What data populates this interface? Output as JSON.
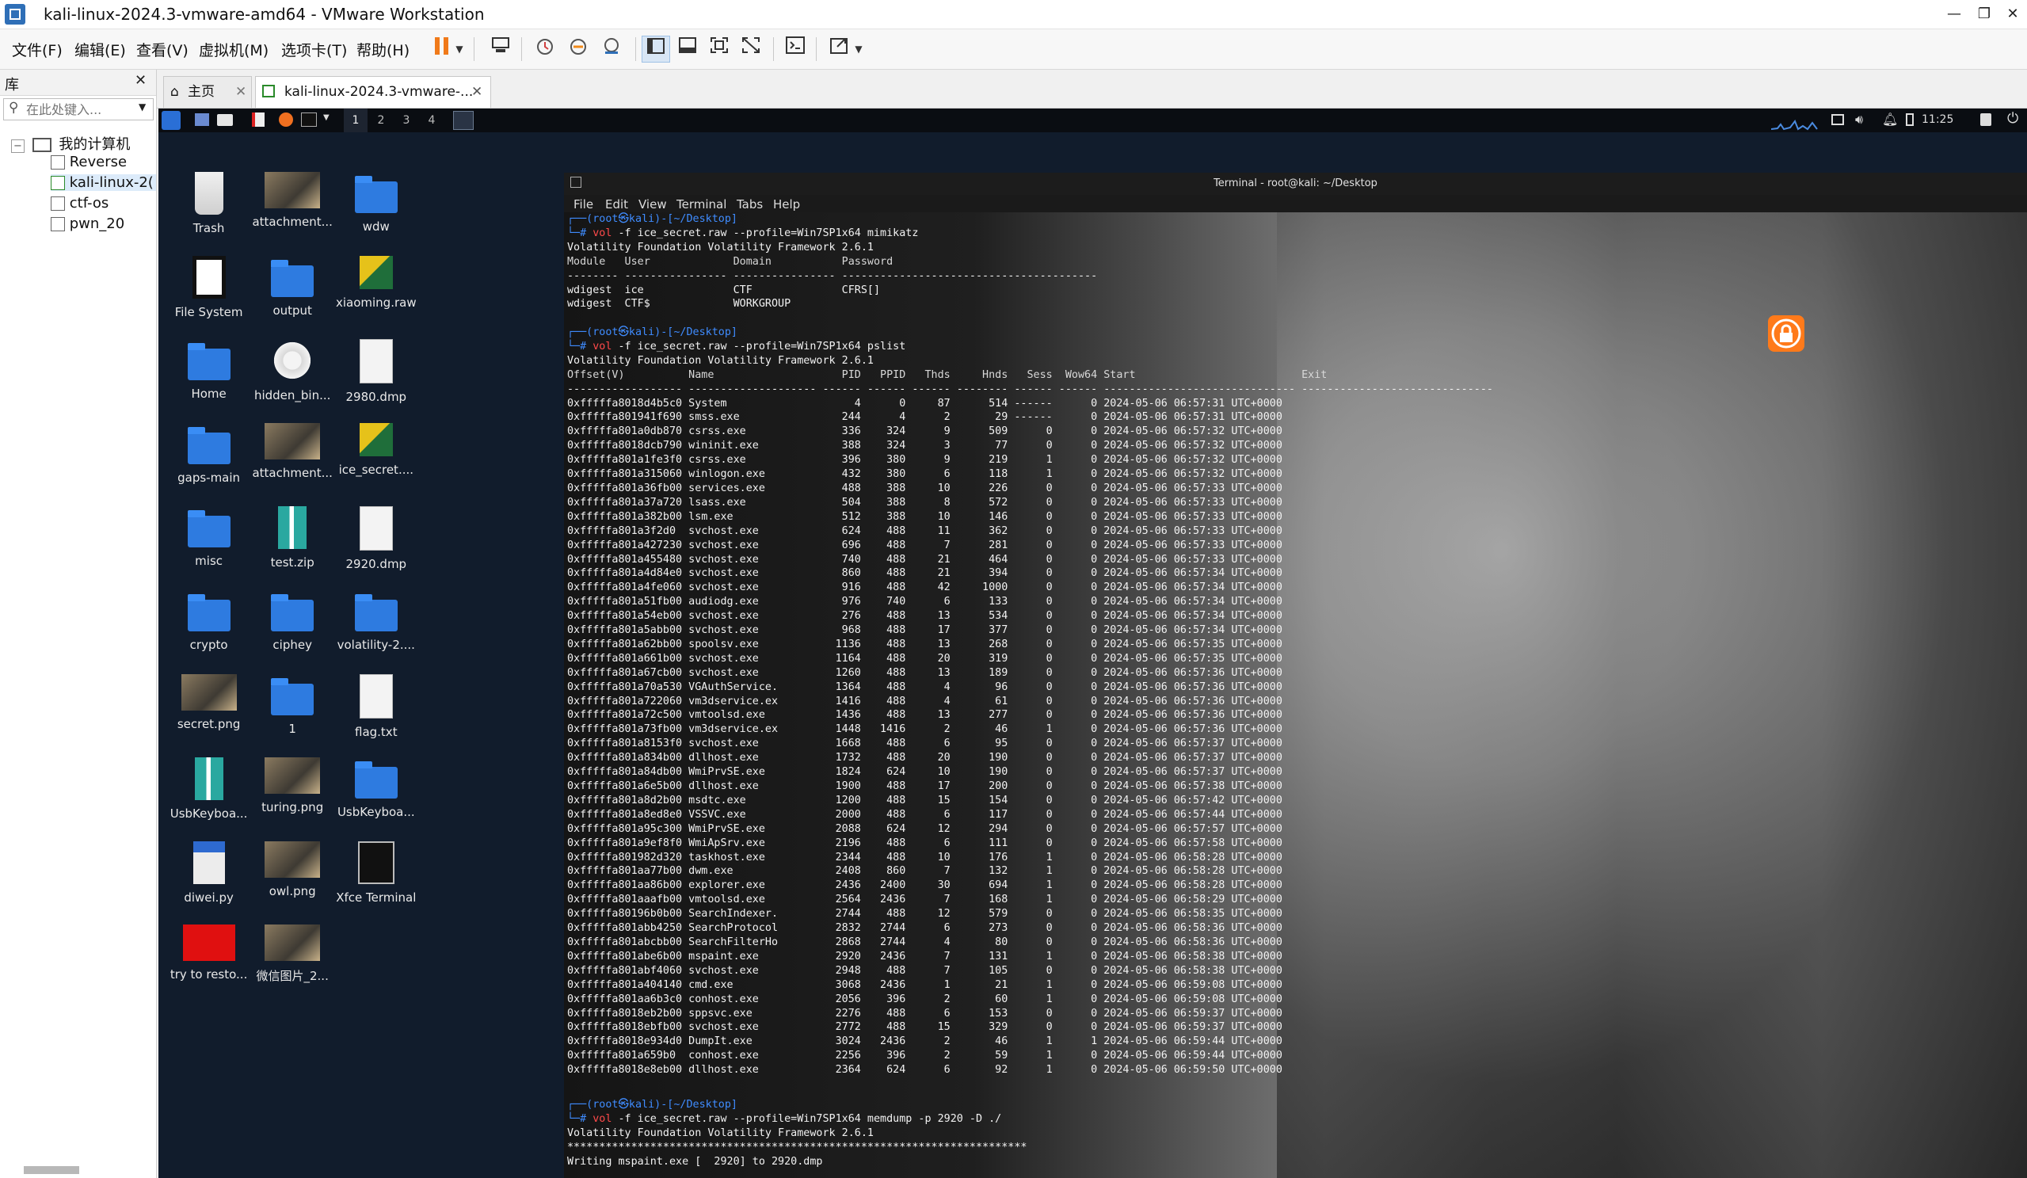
{
  "window": {
    "title": "kali-linux-2024.3-vmware-amd64 - VMware Workstation",
    "controls": [
      "—",
      "❐",
      "✕"
    ]
  },
  "menu": [
    "文件(F)",
    "编辑(E)",
    "查看(V)",
    "虚拟机(M)",
    "选项卡(T)",
    "帮助(H)"
  ],
  "library": {
    "title": "库",
    "search_placeholder": "在此处键入...",
    "root": "我的计算机",
    "vms": [
      "Reverse",
      "kali-linux-2(",
      "ctf-os",
      "pwn_20"
    ]
  },
  "tabs": [
    {
      "label": "主页"
    },
    {
      "label": "kali-linux-2024.3-vmware-..."
    }
  ],
  "panel": {
    "workspaces": [
      "1",
      "2",
      "3",
      "4"
    ],
    "time": "11:25"
  },
  "desktop_icons": [
    {
      "label": "Trash",
      "kind": "trash"
    },
    {
      "label": "attachment...",
      "kind": "image"
    },
    {
      "label": "wdw",
      "kind": "folder"
    },
    {
      "label": "File System",
      "kind": "drive"
    },
    {
      "label": "output",
      "kind": "folder"
    },
    {
      "label": "xiaoming.raw",
      "kind": "raw"
    },
    {
      "label": "Home",
      "kind": "folder"
    },
    {
      "label": "hidden_bin...",
      "kind": "gear"
    },
    {
      "label": "2980.dmp",
      "kind": "doc"
    },
    {
      "label": "gaps-main",
      "kind": "folder"
    },
    {
      "label": "attachment...",
      "kind": "image"
    },
    {
      "label": "ice_secret....",
      "kind": "raw"
    },
    {
      "label": "misc",
      "kind": "folder"
    },
    {
      "label": "test.zip",
      "kind": "zip"
    },
    {
      "label": "2920.dmp",
      "kind": "doc"
    },
    {
      "label": "crypto",
      "kind": "folder"
    },
    {
      "label": "ciphey",
      "kind": "folder"
    },
    {
      "label": "volatility-2....",
      "kind": "folder"
    },
    {
      "label": "secret.png",
      "kind": "image"
    },
    {
      "label": "1",
      "kind": "folder"
    },
    {
      "label": "flag.txt",
      "kind": "doc"
    },
    {
      "label": "UsbKeyboa...",
      "kind": "zip"
    },
    {
      "label": "turing.png",
      "kind": "image"
    },
    {
      "label": "UsbKeyboa...",
      "kind": "folder"
    },
    {
      "label": "diwei.py",
      "kind": "py"
    },
    {
      "label": "owl.png",
      "kind": "image"
    },
    {
      "label": "Xfce Terminal",
      "kind": "terminal"
    },
    {
      "label": "try to resto...",
      "kind": "red"
    },
    {
      "label": "微信图片_2...",
      "kind": "image"
    }
  ],
  "terminal": {
    "title": "Terminal - root@kali: ~/Desktop",
    "menu": [
      "File",
      "Edit",
      "View",
      "Terminal",
      "Tabs",
      "Help"
    ],
    "prompt_top": "┌──(root㉿kali)-[~/Desktop]",
    "prompt_mark": "└─#",
    "cmd1": {
      "bin": "vol",
      "args": " -f ice_secret.raw --profile=Win7SP1x64 mimikatz"
    },
    "banner": "Volatility Foundation Volatility Framework 2.6.1",
    "mimikatz_header": "Module   User             Domain           Password",
    "mimikatz_sep": "-------- ---------------- ---------------- ----------------------------------------",
    "mimikatz_rows": [
      "wdigest  ice              CTF              CFRS[]",
      "wdigest  CTF$             WORKGROUP"
    ],
    "cmd2": {
      "bin": "vol",
      "args": " -f ice_secret.raw --profile=Win7SP1x64 pslist"
    },
    "pslist_header": "Offset(V)          Name                    PID   PPID   Thds     Hnds   Sess  Wow64 Start                          Exit",
    "pslist_sep": "------------------ -------------------- ------ ------ ------ -------- ------ ------ ------------------------------ ------------------------------",
    "pslist_rows": [
      "0xfffffa8018d4b5c0 System                    4      0     87      514 ------      0 2024-05-06 06:57:31 UTC+0000",
      "0xfffffa801941f690 smss.exe                244      4      2       29 ------      0 2024-05-06 06:57:31 UTC+0000",
      "0xfffffa801a0db870 csrss.exe               336    324      9      509      0      0 2024-05-06 06:57:32 UTC+0000",
      "0xfffffa8018dcb790 wininit.exe             388    324      3       77      0      0 2024-05-06 06:57:32 UTC+0000",
      "0xfffffa801a1fe3f0 csrss.exe               396    380      9      219      1      0 2024-05-06 06:57:32 UTC+0000",
      "0xfffffa801a315060 winlogon.exe            432    380      6      118      1      0 2024-05-06 06:57:32 UTC+0000",
      "0xfffffa801a36fb00 services.exe            488    388     10      226      0      0 2024-05-06 06:57:33 UTC+0000",
      "0xfffffa801a37a720 lsass.exe               504    388      8      572      0      0 2024-05-06 06:57:33 UTC+0000",
      "0xfffffa801a382b00 lsm.exe                 512    388     10      146      0      0 2024-05-06 06:57:33 UTC+0000",
      "0xfffffa801a3f2d0  svchost.exe             624    488     11      362      0      0 2024-05-06 06:57:33 UTC+0000",
      "0xfffffa801a427230 svchost.exe             696    488      7      281      0      0 2024-05-06 06:57:33 UTC+0000",
      "0xfffffa801a455480 svchost.exe             740    488     21      464      0      0 2024-05-06 06:57:33 UTC+0000",
      "0xfffffa801a4d84e0 svchost.exe             860    488     21      394      0      0 2024-05-06 06:57:34 UTC+0000",
      "0xfffffa801a4fe060 svchost.exe             916    488     42     1000      0      0 2024-05-06 06:57:34 UTC+0000",
      "0xfffffa801a51fb00 audiodg.exe             976    740      6      133      0      0 2024-05-06 06:57:34 UTC+0000",
      "0xfffffa801a54eb00 svchost.exe             276    488     13      534      0      0 2024-05-06 06:57:34 UTC+0000",
      "0xfffffa801a5abb00 svchost.exe             968    488     17      377      0      0 2024-05-06 06:57:34 UTC+0000",
      "0xfffffa801a62bb00 spoolsv.exe            1136    488     13      268      0      0 2024-05-06 06:57:35 UTC+0000",
      "0xfffffa801a661b00 svchost.exe            1164    488     20      319      0      0 2024-05-06 06:57:35 UTC+0000",
      "0xfffffa801a67cb00 svchost.exe            1260    488     13      189      0      0 2024-05-06 06:57:36 UTC+0000",
      "0xfffffa801a70a530 VGAuthService.         1364    488      4       96      0      0 2024-05-06 06:57:36 UTC+0000",
      "0xfffffa801a722060 vm3dservice.ex         1416    488      4       61      0      0 2024-05-06 06:57:36 UTC+0000",
      "0xfffffa801a72c500 vmtoolsd.exe           1436    488     13      277      0      0 2024-05-06 06:57:36 UTC+0000",
      "0xfffffa801a73fb00 vm3dservice.ex         1448   1416      2       46      1      0 2024-05-06 06:57:36 UTC+0000",
      "0xfffffa801a8153f0 svchost.exe            1668    488      6       95      0      0 2024-05-06 06:57:37 UTC+0000",
      "0xfffffa801a834b00 dllhost.exe            1732    488     20      190      0      0 2024-05-06 06:57:37 UTC+0000",
      "0xfffffa801a84db00 WmiPrvSE.exe           1824    624     10      190      0      0 2024-05-06 06:57:37 UTC+0000",
      "0xfffffa801a6e5b00 dllhost.exe            1900    488     17      200      0      0 2024-05-06 06:57:38 UTC+0000",
      "0xfffffa801a8d2b00 msdtc.exe              1200    488     15      154      0      0 2024-05-06 06:57:42 UTC+0000",
      "0xfffffa801a8ed8e0 VSSVC.exe              2000    488      6      117      0      0 2024-05-06 06:57:44 UTC+0000",
      "0xfffffa801a95c300 WmiPrvSE.exe           2088    624     12      294      0      0 2024-05-06 06:57:57 UTC+0000",
      "0xfffffa801a9ef8f0 WmiApSrv.exe           2196    488      6      111      0      0 2024-05-06 06:57:58 UTC+0000",
      "0xfffffa801982d320 taskhost.exe           2344    488     10      176      1      0 2024-05-06 06:58:28 UTC+0000",
      "0xfffffa801aa77b00 dwm.exe                2408    860      7      132      1      0 2024-05-06 06:58:28 UTC+0000",
      "0xfffffa801aa86b00 explorer.exe           2436   2400     30      694      1      0 2024-05-06 06:58:28 UTC+0000",
      "0xfffffa801aaafb00 vmtoolsd.exe           2564   2436      7      168      1      0 2024-05-06 06:58:29 UTC+0000",
      "0xfffffa80196b0b00 SearchIndexer.         2744    488     12      579      0      0 2024-05-06 06:58:35 UTC+0000",
      "0xfffffa801abb4250 SearchProtocol         2832   2744      6      273      0      0 2024-05-06 06:58:36 UTC+0000",
      "0xfffffa801abcbb00 SearchFilterHo         2868   2744      4       80      0      0 2024-05-06 06:58:36 UTC+0000",
      "0xfffffa801abe6b00 mspaint.exe            2920   2436      7      131      1      0 2024-05-06 06:58:38 UTC+0000",
      "0xfffffa801abf4060 svchost.exe            2948    488      7      105      0      0 2024-05-06 06:58:38 UTC+0000",
      "0xfffffa801a404140 cmd.exe                3068   2436      1       21      1      0 2024-05-06 06:59:08 UTC+0000",
      "0xfffffa801aa6b3c0 conhost.exe            2056    396      2       60      1      0 2024-05-06 06:59:08 UTC+0000",
      "0xfffffa8018eb2b00 sppsvc.exe             2276    488      6      153      0      0 2024-05-06 06:59:37 UTC+0000",
      "0xfffffa8018ebfb00 svchost.exe            2772    488     15      329      0      0 2024-05-06 06:59:37 UTC+0000",
      "0xfffffa8018e934d0 DumpIt.exe             3024   2436      2       46      1      1 2024-05-06 06:59:44 UTC+0000",
      "0xfffffa801a659b0  conhost.exe            2256    396      2       59      1      0 2024-05-06 06:59:44 UTC+0000",
      "0xfffffa8018e8eb00 dllhost.exe            2364    624      6       92      1      0 2024-05-06 06:59:50 UTC+0000"
    ],
    "cmd3": {
      "bin": "vol",
      "args": " -f ice_secret.raw --profile=Win7SP1x64 memdump -p 2920 -D ./"
    },
    "stars": "************************************************************************",
    "writing": "Writing mspaint.exe [  2920] to 2920.dmp"
  }
}
